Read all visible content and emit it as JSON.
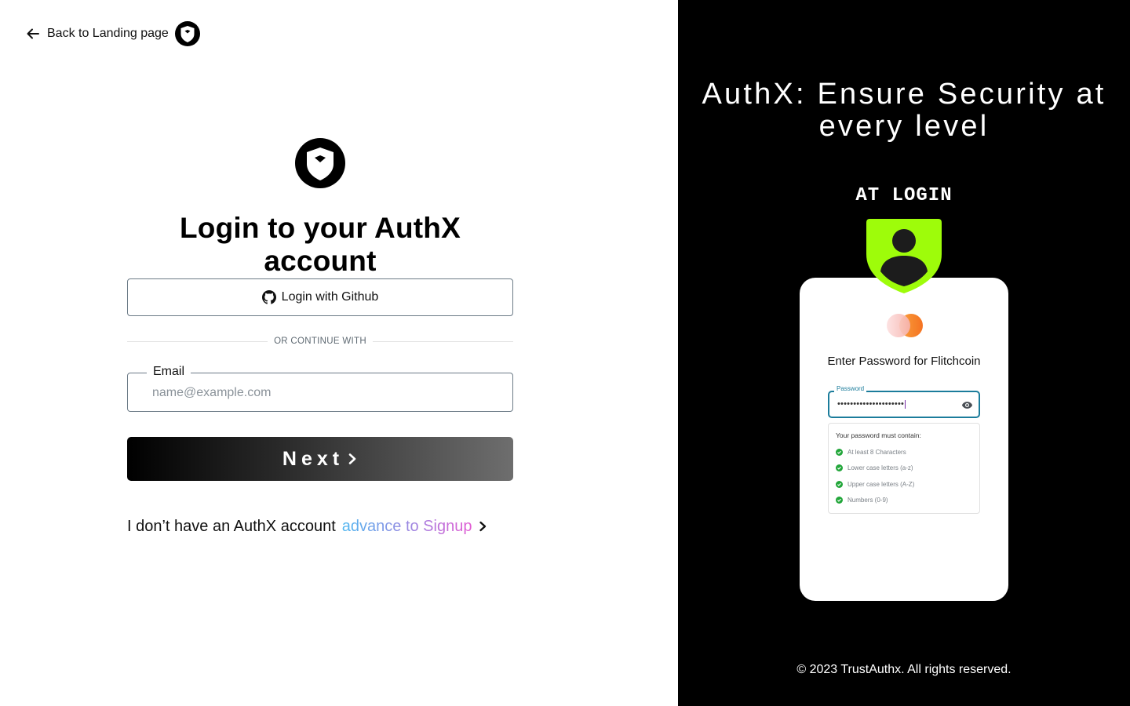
{
  "left": {
    "back_link": {
      "label": "Back to Landing page"
    },
    "title": "Login to your AuthX account",
    "github_button": {
      "label": "Login with Github"
    },
    "divider_text": "OR CONTINUE WITH",
    "email": {
      "label": "Email",
      "placeholder": "name@example.com",
      "value": ""
    },
    "next_button": {
      "label": "Next"
    },
    "signup": {
      "text": "I don’t have an AuthX account",
      "link": "advance to Signup"
    }
  },
  "right": {
    "hero_title": "AuthX: Ensure Security at every level",
    "subtitle": "AT LOGIN",
    "card": {
      "prompt": "Enter Password for Flitchcoin",
      "password_label": "Password",
      "password_masked": "•••••••••••••••••••••",
      "rules_heading": "Your password must contain:",
      "rules": [
        {
          "label": "At least 8 Characters",
          "met": true
        },
        {
          "label": "Lower case letters (a-z)",
          "met": true
        },
        {
          "label": "Upper case letters (A-Z)",
          "met": true
        },
        {
          "label": "Numbers (0-9)",
          "met": true
        }
      ]
    },
    "copyright": "© 2023 TrustAuthx. All rights reserved."
  },
  "colors": {
    "accent_green": "#9efc0a",
    "focus_blue": "#1b7c9b",
    "check_green": "#22a63a",
    "signup_gradient_start": "#4fb7f0",
    "signup_gradient_end": "#e25bd3"
  },
  "icons": [
    "arrow-left-icon",
    "authx-logo-icon",
    "github-icon",
    "chevron-right-icon",
    "user-shield-icon",
    "coins-icon",
    "eye-icon",
    "check-circle-icon"
  ]
}
